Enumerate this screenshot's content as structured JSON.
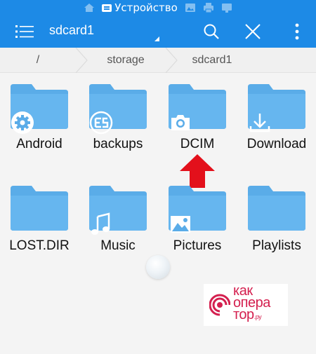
{
  "statusbar": {
    "device_label": "Устройство"
  },
  "toolbar": {
    "title": "sdcard1"
  },
  "breadcrumbs": [
    {
      "label": "/"
    },
    {
      "label": "storage"
    },
    {
      "label": "sdcard1"
    }
  ],
  "folders": [
    {
      "name": "Android",
      "badge": "gear-icon"
    },
    {
      "name": "backups",
      "badge": "es-logo-icon"
    },
    {
      "name": "DCIM",
      "badge": "camera-icon"
    },
    {
      "name": "Download",
      "badge": "download-icon"
    },
    {
      "name": "LOST.DIR",
      "badge": ""
    },
    {
      "name": "Music",
      "badge": "music-note-icon"
    },
    {
      "name": "Pictures",
      "badge": "image-icon"
    },
    {
      "name": "Playlists",
      "badge": ""
    }
  ],
  "watermark": {
    "line1": "как",
    "line2": "опера",
    "line3": "тор",
    "suffix": ".ру"
  },
  "colors": {
    "accent": "#1d8ae6",
    "folder": "#5aace8",
    "arrow": "#e3101b",
    "watermark": "#d4204f"
  }
}
